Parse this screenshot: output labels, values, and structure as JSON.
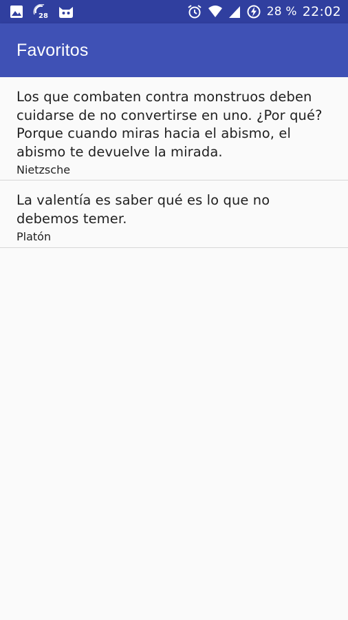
{
  "status_bar": {
    "left_icons": [
      "image-icon",
      "notification-28-icon",
      "cat-face-icon"
    ],
    "badge": "28",
    "right_icons": [
      "alarm-icon",
      "wifi-icon",
      "signal-icon",
      "battery-charging-icon"
    ],
    "battery_text": "28 %",
    "time": "22:02",
    "color": "#303f9f"
  },
  "app_bar": {
    "title": "Favoritos",
    "color": "#3f51b5"
  },
  "favorites": [
    {
      "quote": "Los que combaten contra monstruos deben cuidarse de no convertirse en uno. ¿Por qué? Porque cuando miras hacia el abismo, el abismo te devuelve la mirada.",
      "author": "Nietzsche"
    },
    {
      "quote": "La valentía es saber qué es lo que no debemos temer.",
      "author": "Platón"
    }
  ]
}
